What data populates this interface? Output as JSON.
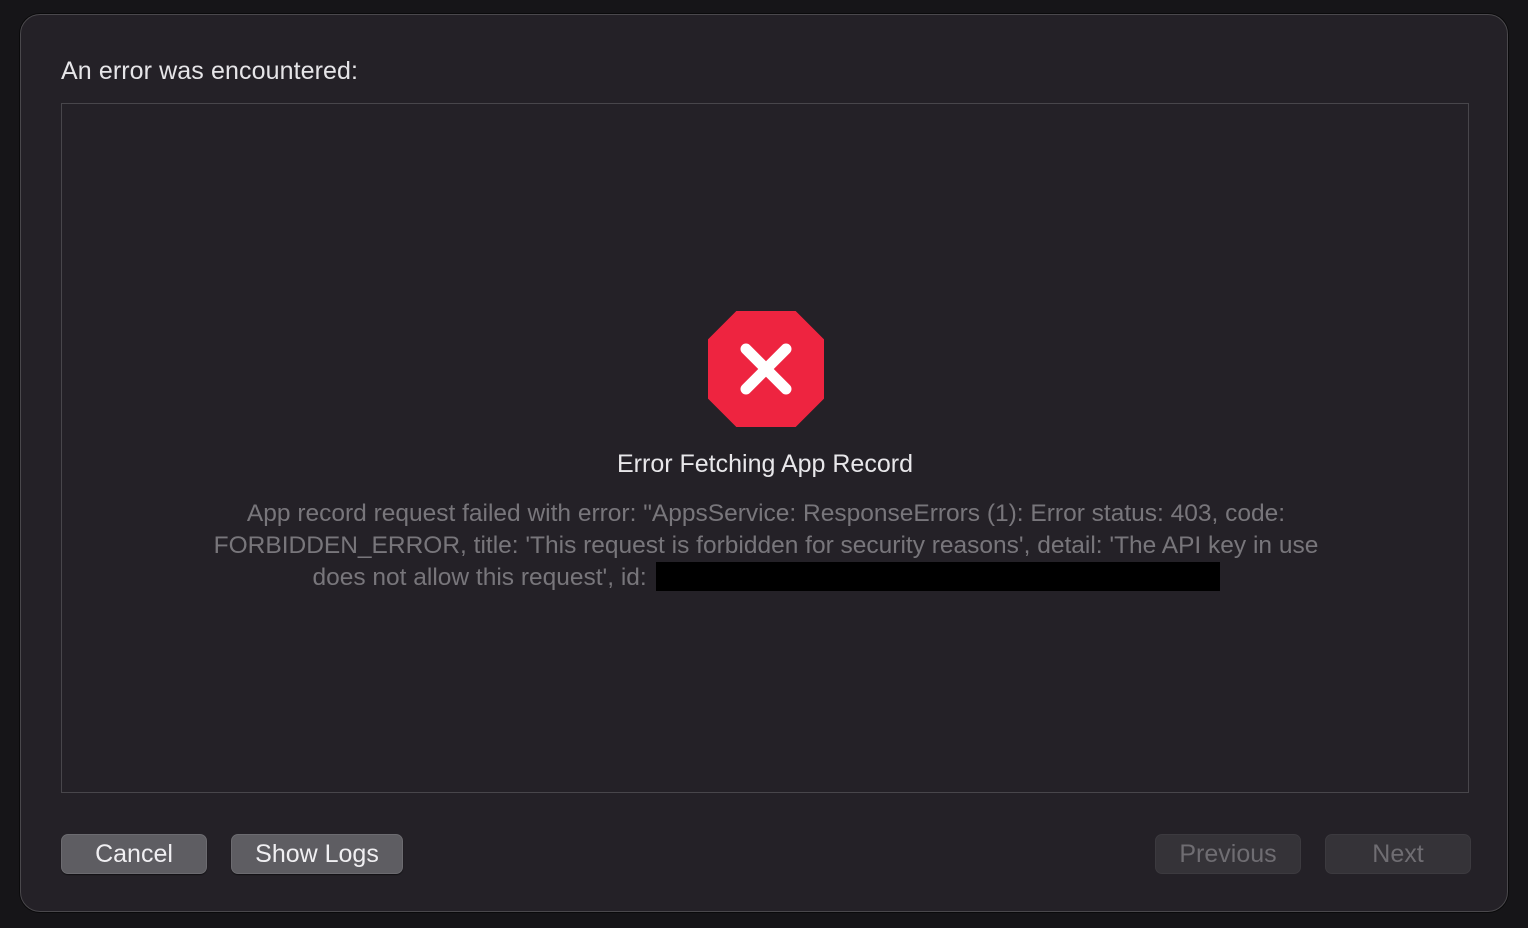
{
  "dialog": {
    "header_label": "An error was encountered:",
    "error": {
      "icon": "error-octagon-x-icon",
      "icon_color": "#ee2440",
      "title": "Error Fetching App Record",
      "detail_line1": "App record request failed with error: \"AppsService: ResponseErrors (1): Error status: 403, code:",
      "detail_line2": "FORBIDDEN_ERROR, title: 'This request is forbidden for security reasons', detail: 'The API key in use",
      "detail_line3": "does not allow this request', id: "
    },
    "buttons": {
      "cancel": "Cancel",
      "show_logs": "Show Logs",
      "previous": "Previous",
      "next": "Next"
    }
  }
}
